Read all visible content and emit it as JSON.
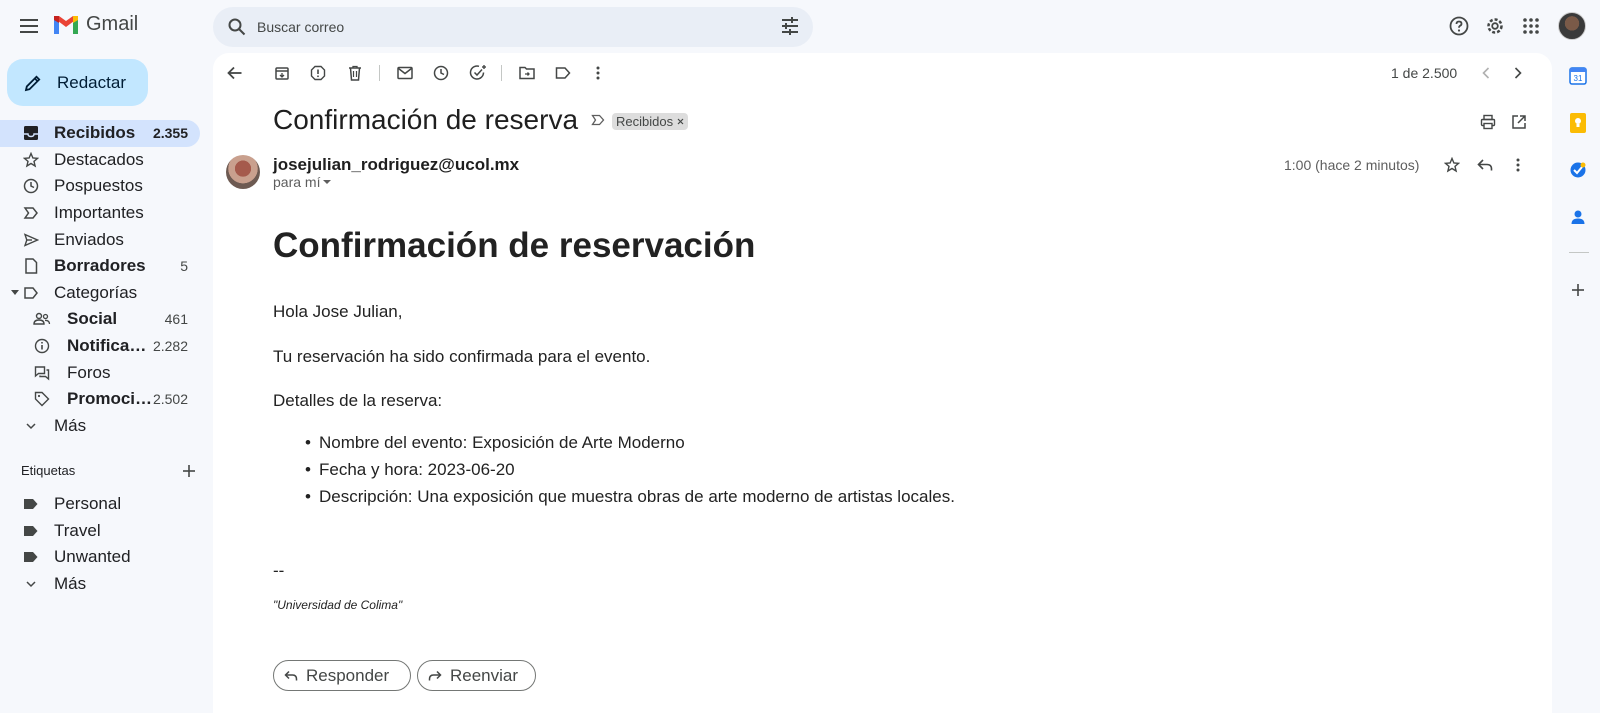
{
  "app": {
    "name": "Gmail"
  },
  "search": {
    "placeholder": "Buscar correo"
  },
  "compose": {
    "label": "Redactar"
  },
  "nav": {
    "items": [
      {
        "label": "Recibidos",
        "count": "2.355"
      },
      {
        "label": "Destacados",
        "count": ""
      },
      {
        "label": "Pospuestos",
        "count": ""
      },
      {
        "label": "Importantes",
        "count": ""
      },
      {
        "label": "Enviados",
        "count": ""
      },
      {
        "label": "Borradores",
        "count": "5"
      },
      {
        "label": "Categorías",
        "count": ""
      }
    ],
    "categories": [
      {
        "label": "Social",
        "count": "461"
      },
      {
        "label": "Notificaciones",
        "count": "2.282"
      },
      {
        "label": "Foros",
        "count": ""
      },
      {
        "label": "Promociones",
        "count": "2.502"
      }
    ],
    "more": "Más"
  },
  "labels_section": {
    "title": "Etiquetas",
    "items": [
      "Personal",
      "Travel",
      "Unwanted"
    ],
    "more": "Más"
  },
  "toolbar": {
    "pager": "1 de 2.500"
  },
  "email": {
    "subject": "Confirmación de reserva",
    "label_chip": "Recibidos",
    "sender": "josejulian_rodriguez@ucol.mx",
    "to": "para mí",
    "time": "1:00 (hace 2 minutos)",
    "body_title": "Confirmación de reservación",
    "greeting": "Hola Jose Julian,",
    "line1": "Tu reservación ha sido confirmada para el evento.",
    "details_heading": "Detalles de la reserva:",
    "details": [
      "Nombre del evento: Exposición de Arte Moderno",
      "Fecha y hora: 2023-06-20",
      "Descripción: Una exposición que muestra obras de arte moderno de artistas locales."
    ],
    "sig_dash": "--",
    "signature": "\"Universidad de Colima\""
  },
  "actions": {
    "reply": "Responder",
    "forward": "Reenviar"
  },
  "colors": {
    "accent": "#0b57d0",
    "compose_bg": "#c2e7ff",
    "active_nav": "#d3e3fd",
    "page_bg": "#f6f8fc"
  }
}
